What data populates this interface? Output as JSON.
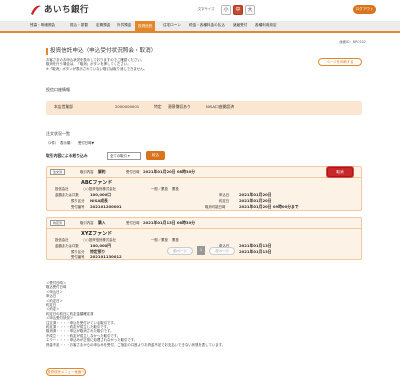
{
  "header": {
    "logo_text": "あいち銀行",
    "size_label": "文字サイズ",
    "size_options": [
      "小",
      "中",
      "大"
    ],
    "logout_label": "ログアウト"
  },
  "nav": {
    "items": [
      "残高・明細照会",
      "振込・振替",
      "定期預金",
      "外貨預金",
      "投資信託",
      "住宅ローン",
      "税金・各種料金の払込",
      "諸届受付",
      "各種利用設定"
    ],
    "active_index": 4
  },
  "page": {
    "screen_id": "画面ID：BPO102",
    "title": "投資信託申込（申込受付状況照会・取消）",
    "description": [
      "お客さまのお申込状況を表示しておりますのでご確認ください。",
      "取消を行う場合は、「取消」ボタンを押してください。",
      "※「取消」ボタンが表示されていない取引は取り消しできません。"
    ],
    "print_label": "ページを印刷する"
  },
  "account": {
    "section_title": "投信口座情報",
    "branch": "本店営業部",
    "number": "2000000001",
    "type": "特定",
    "withholding": "源泉徴収あり",
    "nisa": "NISA口座開設済"
  },
  "orders": {
    "section_title": "注文状況一覧",
    "count_label": "（2件）",
    "sort_label": "表示順：",
    "sort_value": "受付日時▼",
    "filter_label": "取引内容による絞り込み",
    "filter_value": "全ての取引",
    "filter_button": "絞込"
  },
  "cards": [
    {
      "badge": "注文済",
      "trade_label": "取引内容",
      "trade_value": "解約",
      "recv_label": "受付日時",
      "recv_value": "2021年01月20日 08時30分",
      "fund_name": "ABCファンド",
      "mgr_label": "投信会社",
      "mgr_value": "○○投資信託株式会社",
      "class_label": "一般／累投",
      "class_value": "累投",
      "amount_label": "金額または口数",
      "amount_value": "100,000口",
      "account_label": "預り区分",
      "account_value": "NISA成長",
      "recno_label": "受付番号",
      "recno_value": "202101200001",
      "apply_label": "申込日",
      "apply_value": "2021年01月20日",
      "contract_label": "約定日",
      "contract_value": "2021年01月20日",
      "deadline_label": "取消可能日時",
      "deadline_value": "2021年01月20日 09時00分まで",
      "cancel_label": "取消",
      "has_cancel": true
    },
    {
      "badge": "約定済",
      "trade_label": "取引内容",
      "trade_value": "購入",
      "recv_label": "受付日時",
      "recv_value": "2021年01月13日 08時30分",
      "fund_name": "XYZファンド",
      "mgr_label": "投信会社",
      "mgr_value": "○○投資信託株式会社",
      "class_label": "一般／累投",
      "class_value": "累投",
      "amount_label": "金額または口数",
      "amount_value": "100,000円",
      "account_label": "預り区分",
      "account_value": "特定預り",
      "recno_label": "受付番号",
      "recno_value": "202101130012",
      "apply_label": "申込日",
      "apply_value": "2021年01月13日",
      "contract_label": "約定日",
      "contract_value": "2021年01月13日",
      "deadline_label": "",
      "deadline_value": "",
      "cancel_label": "",
      "has_cancel": false
    }
  ],
  "pager": {
    "prev": "前ページ",
    "current": "1",
    "next": "次ページ"
  },
  "legend": [
    "＜受付日時＞",
    "取込受付日時",
    "＜申込日＞",
    "申込日",
    "＜約定日＞",
    "約定日",
    "＜約定＞",
    "約定日の前日に約定金額確定済",
    "＜申込受付状況＞",
    "注文済・・・・申込を受付けている取引です。",
    "約定済・・・・約定が成立した取引です。",
    "取消済・・・・申込が取消された取引です。",
    "不成立・・・・約定が成立しなかった取引です。",
    "エラー・・・・申込みが正常に処理されなかった取引です。",
    "資金不足・・・お客さまからの申込みを受付、ご指定の口座よりお資金不足でお支払いできない状態を表しています。"
  ],
  "footer": {
    "menu_label": "投資信託メニュー画面へ"
  },
  "colors": {
    "accent": "#e2872b",
    "brand_red": "#c8282a",
    "card_bg": "#fdf2e6",
    "account_bg": "#fbe6d2"
  }
}
